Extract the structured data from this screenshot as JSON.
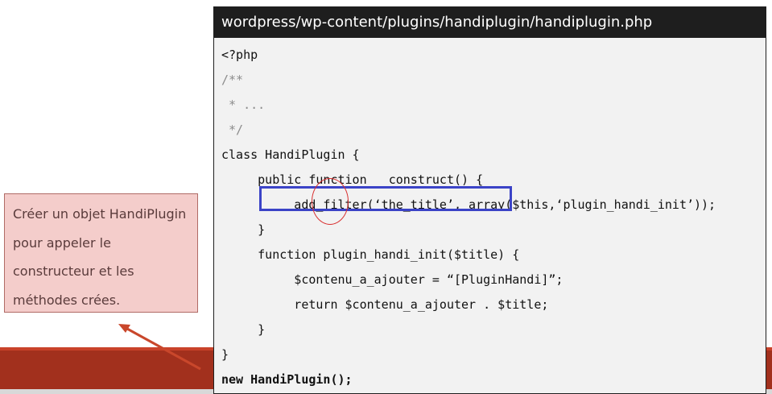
{
  "code_window": {
    "title": "wordpress/wp-content/plugins/handiplugin/handiplugin.php",
    "lines": [
      "<?php",
      "/**",
      " * ...",
      " */",
      "class HandiPlugin {",
      "     public function __construct() {",
      "          add_filter(‘the_title’, array($this,‘plugin_handi_init’));",
      "     }",
      "     function plugin_handi_init($title) {",
      "          $contenu_a_ajouter = “[PluginHandi]”;",
      "          return $contenu_a_ajouter . $title;",
      "     }",
      "}",
      "new HandiPlugin();"
    ]
  },
  "note": {
    "lines": [
      "Créer un objet HandiPlugin",
      "pour appeler le",
      "constructeur et les",
      "méthodes crées."
    ]
  },
  "colors": {
    "highlight_box": "#3b43c7",
    "highlight_circle": "#d93030",
    "arrow": "#c9472b",
    "note_bg": "#f4cdcb",
    "band": "#a2301d"
  }
}
